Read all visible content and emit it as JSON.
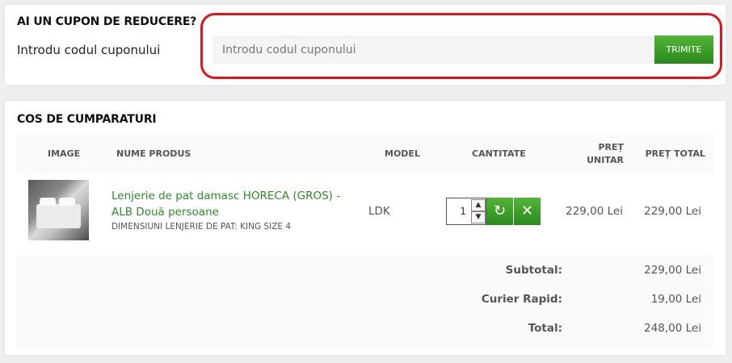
{
  "coupon": {
    "title": "AI UN CUPON DE REDUCERE?",
    "label": "Introdu codul cuponului",
    "input_value": "",
    "placeholder": "Introdu codul cuponului",
    "submit_label": "TRIMITE"
  },
  "cart": {
    "title": "COS DE CUMPARATURI",
    "headers": {
      "image": "IMAGE",
      "name": "NUME PRODUS",
      "model": "MODEL",
      "quantity": "CANTITATE",
      "unit_price": "PREȚ UNITAR",
      "total_price": "PREȚ TOTAL"
    },
    "items": [
      {
        "name": "Lenjerie de pat damasc HORECA (GROS) - ALB Două persoane",
        "option": "DIMENSIUNI LENJERIE DE PAT: KING SIZE 4",
        "model": "LDK",
        "quantity": "1",
        "unit_price": "229,00 Lei",
        "total_price": "229,00 Lei"
      }
    ],
    "totals": [
      {
        "label": "Subtotal:",
        "value": "229,00 Lei"
      },
      {
        "label": "Curier Rapid:",
        "value": "19,00 Lei"
      },
      {
        "label": "Total:",
        "value": "248,00 Lei"
      }
    ]
  },
  "colors": {
    "accent_green": "#2e8b2b",
    "button_green": "#3fa52b",
    "highlight_red": "#e1141b"
  }
}
